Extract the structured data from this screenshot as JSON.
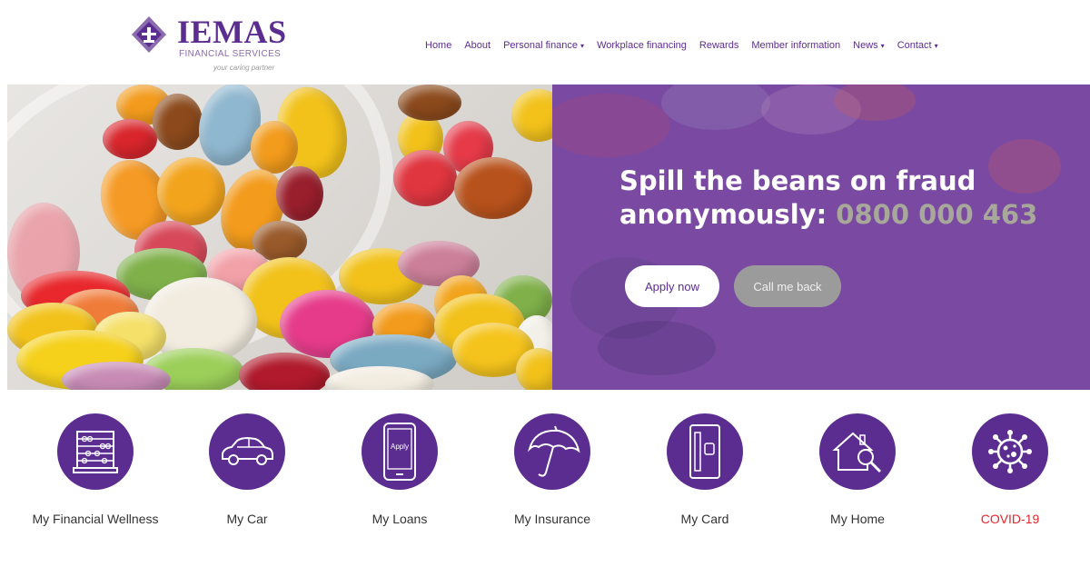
{
  "brand": {
    "name": "IEMAS",
    "subtitle": "FINANCIAL SERVICES",
    "tagline": "your caring partner",
    "primary_color": "#5c2d91",
    "alert_color": "#e3262c"
  },
  "nav": {
    "items": [
      {
        "label": "Home",
        "dropdown": false
      },
      {
        "label": "About",
        "dropdown": false
      },
      {
        "label": "Personal finance",
        "dropdown": true
      },
      {
        "label": "Workplace financing",
        "dropdown": false
      },
      {
        "label": "Rewards",
        "dropdown": false
      },
      {
        "label": "Member information",
        "dropdown": false
      },
      {
        "label": "News",
        "dropdown": true
      },
      {
        "label": "Contact",
        "dropdown": true
      }
    ],
    "caret": "▾"
  },
  "hero": {
    "title_line1": "Spill the beans on fraud",
    "title_line2": "anonymously:",
    "phone": "0800 000 463",
    "apply_label": "Apply now",
    "callback_label": "Call me back"
  },
  "services": [
    {
      "label": "My Financial Wellness",
      "icon": "abacus-icon"
    },
    {
      "label": "My Car",
      "icon": "car-icon"
    },
    {
      "label": "My Loans",
      "icon": "phone-apply-icon",
      "icon_text": "Apply"
    },
    {
      "label": "My Insurance",
      "icon": "umbrella-icon"
    },
    {
      "label": "My Card",
      "icon": "card-icon"
    },
    {
      "label": "My Home",
      "icon": "house-search-icon"
    },
    {
      "label": "COVID-19",
      "icon": "virus-icon"
    }
  ]
}
